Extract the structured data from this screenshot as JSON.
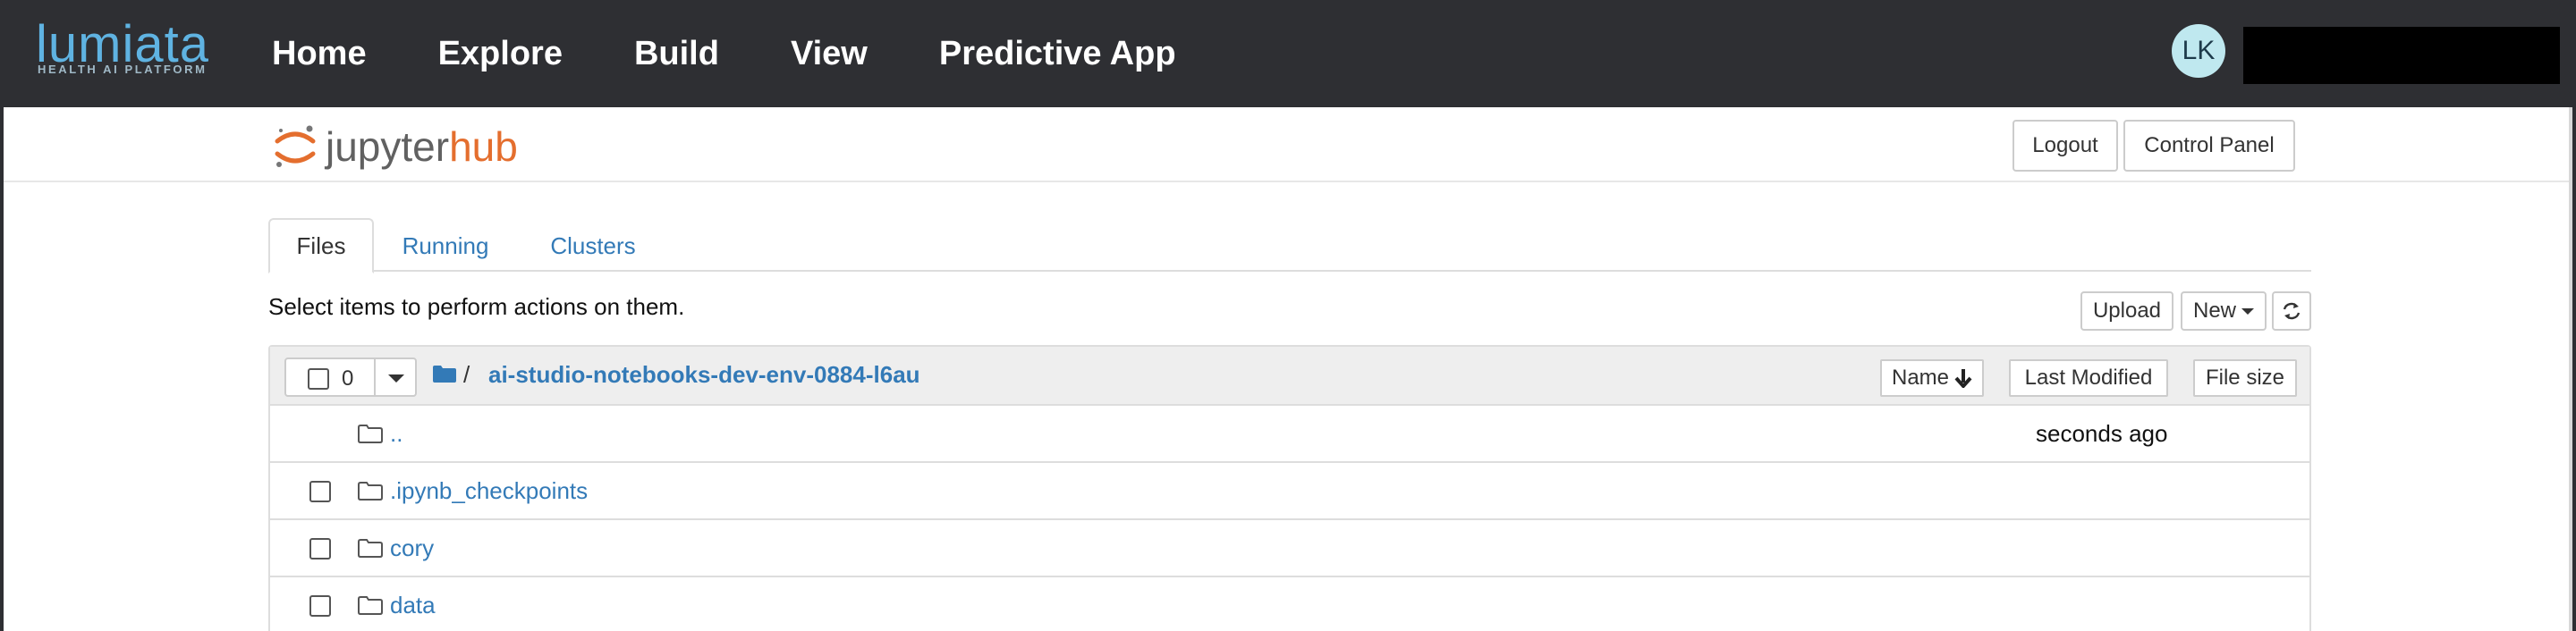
{
  "app": {
    "brand_name": "lumiata",
    "brand_tagline": "HEALTH AI PLATFORM",
    "brand_color": "#5fb3e2"
  },
  "nav": {
    "items": [
      {
        "label": "Home"
      },
      {
        "label": "Explore"
      },
      {
        "label": "Build"
      },
      {
        "label": "View"
      },
      {
        "label": "Predictive App"
      }
    ]
  },
  "user": {
    "initials": "LK",
    "avatar_color": "#bfe8ef"
  },
  "hub": {
    "logo_part1": "jupyter",
    "logo_part2": "hub",
    "logo_accent": "#e46e2e",
    "logout_label": "Logout",
    "control_panel_label": "Control Panel"
  },
  "tabs": [
    {
      "label": "Files",
      "active": true
    },
    {
      "label": "Running",
      "active": false
    },
    {
      "label": "Clusters",
      "active": false
    }
  ],
  "toolbar": {
    "hint": "Select items to perform actions on them.",
    "upload_label": "Upload",
    "new_label": "New",
    "refresh_icon": "refresh-icon"
  },
  "file_list": {
    "selected_count": "0",
    "breadcrumb_sep": "/",
    "current_path": "ai-studio-notebooks-dev-env-0884-l6au",
    "sort_name_label": "Name",
    "sort_modified_label": "Last Modified",
    "sort_size_label": "File size",
    "rows": [
      {
        "name": "..",
        "modified": "seconds ago",
        "has_checkbox": false
      },
      {
        "name": ".ipynb_checkpoints",
        "modified": "",
        "has_checkbox": true
      },
      {
        "name": "cory",
        "modified": "",
        "has_checkbox": true
      },
      {
        "name": "data",
        "modified": "",
        "has_checkbox": true
      }
    ]
  },
  "colors": {
    "topbar_bg": "#2e2f33",
    "link": "#337ab7"
  }
}
